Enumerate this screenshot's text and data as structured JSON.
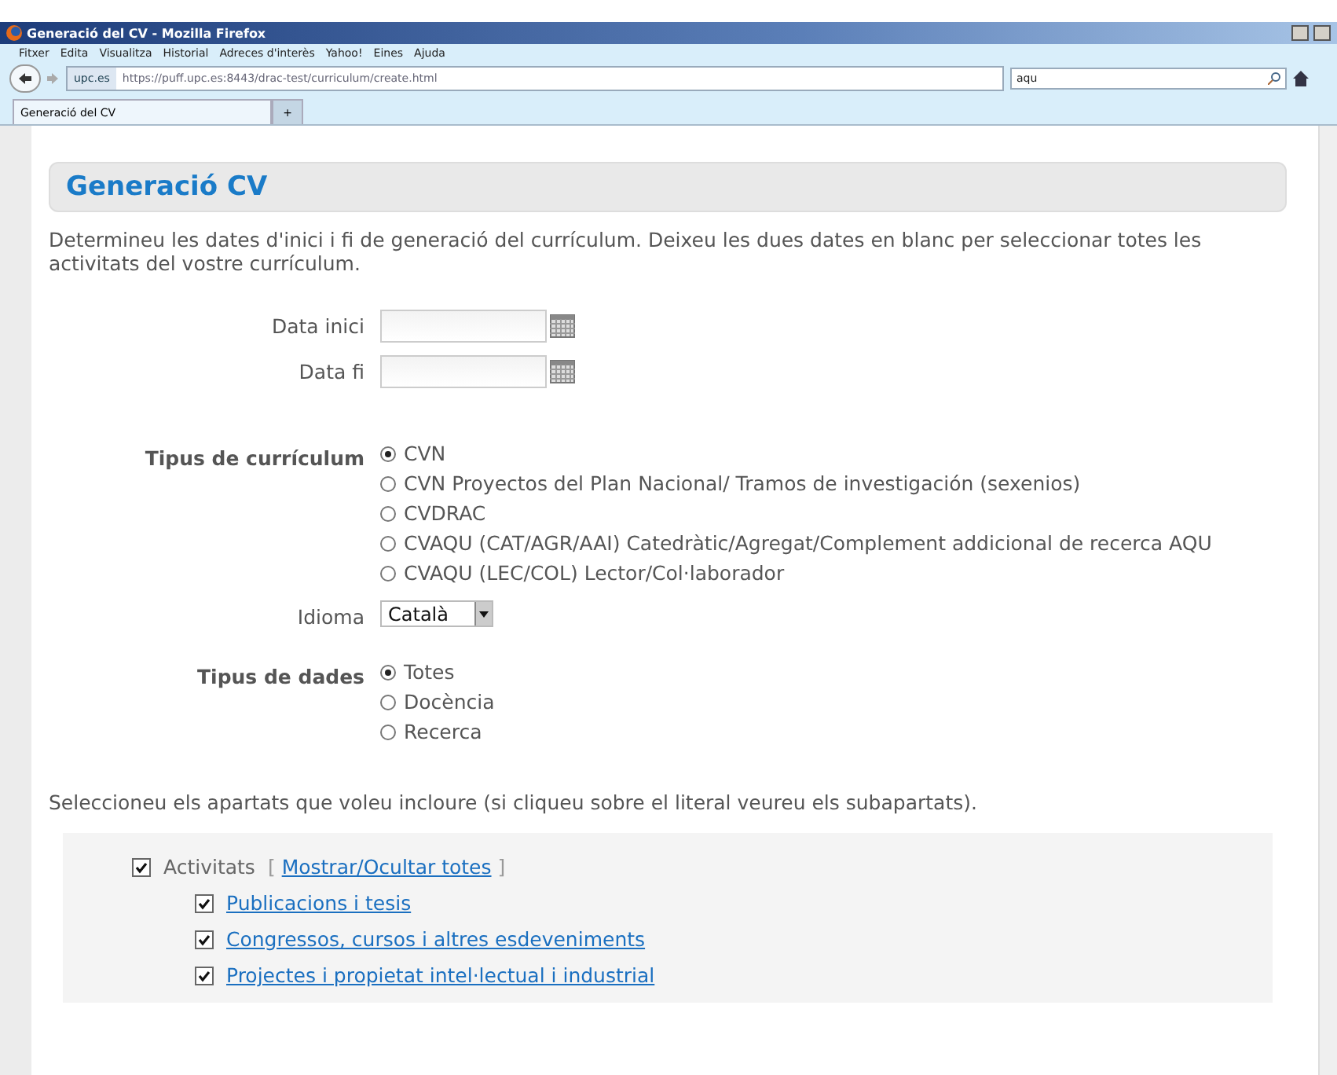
{
  "window": {
    "title": "Generació del CV - Mozilla Firefox"
  },
  "menu": [
    "Fitxer",
    "Edita",
    "Visualitza",
    "Historial",
    "Adreces d'interès",
    "Yahoo!",
    "Eines",
    "Ajuda"
  ],
  "navigation": {
    "site": "upc.es",
    "url": "https://puff.upc.es:8443/drac-test/curriculum/create.html",
    "search_value": "aqu"
  },
  "tabs": [
    {
      "label": "Generació del CV",
      "selected": true
    },
    {
      "label": "+",
      "selected": false
    }
  ],
  "page": {
    "heading": "Generació CV",
    "intro": "Determineu les dates d'inici i fi de generació del currículum. Deixeu les dues dates en blanc per seleccionar totes les activitats del vostre currículum.",
    "date_fields": [
      {
        "label": "Data inici"
      },
      {
        "label": "Data fi"
      }
    ],
    "cv_type": {
      "label": "Tipus de currículum",
      "options": [
        {
          "label": "CVN",
          "selected": true
        },
        {
          "label": "CVN Proyectos del Plan Nacional/ Tramos de investigación (sexenios)",
          "selected": false
        },
        {
          "label": "CVDRAC",
          "selected": false
        },
        {
          "label": "CVAQU (CAT/AGR/AAI) Catedràtic/Agregat/Complement addicional de recerca AQU",
          "selected": false
        },
        {
          "label": "CVAQU (LEC/COL) Lector/Col·laborador",
          "selected": false
        }
      ]
    },
    "language": {
      "label": "Idioma",
      "value": "Català"
    },
    "data_type": {
      "label": "Tipus de dades",
      "options": [
        {
          "label": "Totes",
          "selected": true
        },
        {
          "label": "Docència",
          "selected": false
        },
        {
          "label": "Recerca",
          "selected": false
        }
      ]
    },
    "sections_intro": "Seleccioneu els apartats que voleu incloure (si cliqueu sobre el literal veureu els subapartats).",
    "sections": {
      "label": "Activitats",
      "bracket_open": "[",
      "toggle_link": "Mostrar/Ocultar totes",
      "bracket_close": "]",
      "checked": true,
      "children": [
        {
          "label": "Publicacions i tesis",
          "checked": true
        },
        {
          "label": "Congressos, cursos i altres esdeveniments",
          "checked": true
        },
        {
          "label": "Projectes i propietat intel·lectual i industrial",
          "checked": true
        }
      ]
    }
  }
}
